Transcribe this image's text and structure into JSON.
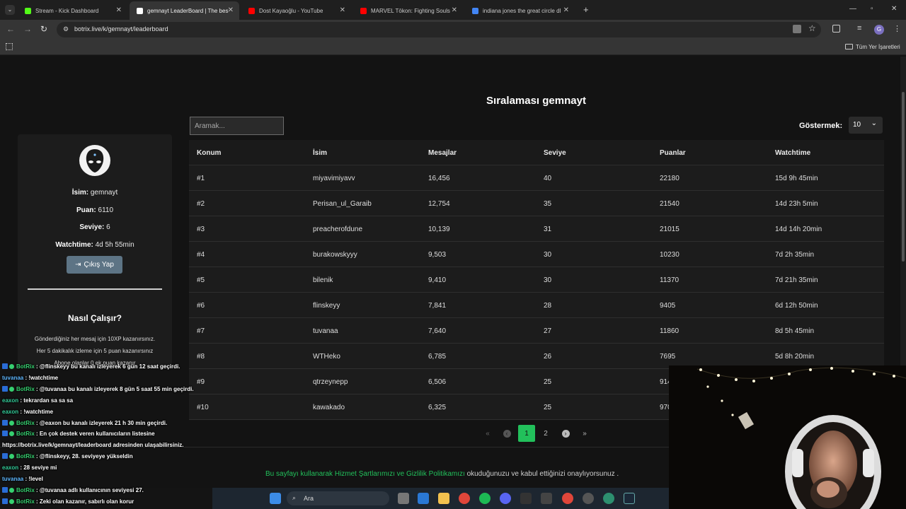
{
  "browser": {
    "tabs": [
      {
        "title": "Stream - Kick Dashboard",
        "color": "#53fc18",
        "active": false
      },
      {
        "title": "gemnayt LeaderBoard | The best",
        "color": "#ffffff",
        "active": true
      },
      {
        "title": "Dost Kayaoğlu - YouTube",
        "color": "#ff0000",
        "active": false
      },
      {
        "title": "MARVEL Tōkon: Fighting Souls",
        "color": "#ff0000",
        "active": false
      },
      {
        "title": "indiana jones the great circle dl",
        "color": "#4285f4",
        "active": false
      }
    ],
    "new_tab": "+",
    "url": "botrix.live/k/gemnayt/leaderboard",
    "bookmarks_label": "Tüm Yer İşaretleri"
  },
  "leaderboard": {
    "title": "Sıralaması gemnayt",
    "search_placeholder": "Aramak...",
    "show_label": "Göstermek:",
    "show_value": "10",
    "columns": [
      "Konum",
      "İsim",
      "Mesajlar",
      "Seviye",
      "Puanlar",
      "Watchtime"
    ],
    "rows": [
      [
        "#1",
        "miyavimiyavv",
        "16,456",
        "40",
        "22180",
        "15d 9h 45min"
      ],
      [
        "#2",
        "Perisan_ul_Garaib",
        "12,754",
        "35",
        "21540",
        "14d 23h 5min"
      ],
      [
        "#3",
        "preacherofdune",
        "10,139",
        "31",
        "21015",
        "14d 14h 20min"
      ],
      [
        "#4",
        "burakowskyyy",
        "9,503",
        "30",
        "10230",
        "7d 2h 35min"
      ],
      [
        "#5",
        "bilenik",
        "9,410",
        "30",
        "11370",
        "7d 21h 35min"
      ],
      [
        "#6",
        "flinskeyy",
        "7,841",
        "28",
        "9405",
        "6d 12h 50min"
      ],
      [
        "#7",
        "tuvanaa",
        "7,640",
        "27",
        "11860",
        "8d 5h 45min"
      ],
      [
        "#8",
        "WTHeko",
        "6,785",
        "26",
        "7695",
        "5d 8h 20min"
      ],
      [
        "#9",
        "qtrzeynepp",
        "6,506",
        "25",
        "914",
        ""
      ],
      [
        "#10",
        "kawakado",
        "6,325",
        "25",
        "970",
        ""
      ]
    ],
    "pagination": {
      "first": "«",
      "prev": "‹",
      "pages": [
        "1",
        "2"
      ],
      "next": "›",
      "last": "»",
      "current": "1"
    }
  },
  "profile": {
    "name_label": "İsim:",
    "name": "gemnayt",
    "points_label": "Puan:",
    "points": "6110",
    "level_label": "Seviye:",
    "level": "6",
    "watchtime_label": "Watchtime:",
    "watchtime": "4d 5h 55min",
    "logout": "Çıkış Yap",
    "how_title": "Nasıl Çalışır?",
    "how_lines": [
      "Gönderdiğiniz her mesaj için 10XP kazanırsınız.",
      "Her 5 dakikalık izleme için 5 puan kazanırsınız",
      "Abone olanlar 0 ek puan kazanır"
    ]
  },
  "footer": {
    "prefix": "Bu sayfayı kullanarak",
    "terms": "Hizmet Şartlarımızı",
    "and": "ve",
    "privacy": "Gizlilik Politikamızı",
    "suffix": "okuduğunuzu ve kabul ettiğinizi onaylıyorsunuz ."
  },
  "chat": [
    {
      "user": "BotRix",
      "type": "bot",
      "text": "@flinskeyy bu kanalı izleyerek 6 gün 12 saat geçirdi."
    },
    {
      "user": "tuvanaa",
      "type": "blue",
      "text": "!watchtime"
    },
    {
      "user": "BotRix",
      "type": "bot",
      "text": "@tuvanaa bu kanalı izleyerek 8 gün 5 saat 55 min geçirdi."
    },
    {
      "user": "eaxon",
      "type": "green",
      "text": "tekrardan sa sa sa"
    },
    {
      "user": "eaxon",
      "type": "green",
      "text": "!watchtime"
    },
    {
      "user": "BotRix",
      "type": "bot",
      "text": "@eaxon bu kanalı izleyerek 21 h 30 min geçirdi."
    },
    {
      "user": "BotRix",
      "type": "bot",
      "text": "En çok destek veren kullanıcıların listesine"
    },
    {
      "user": "",
      "type": "plain",
      "text": "https://botrix.live/k/gemnayt/leaderboard adresinden ulaşabilirsiniz."
    },
    {
      "user": "BotRix",
      "type": "bot",
      "text": "@flinskeyy, 28. seviyeye yükseldin"
    },
    {
      "user": "eaxon",
      "type": "green",
      "text": "28 seviye mi"
    },
    {
      "user": "tuvanaa",
      "type": "blue",
      "text": "!level"
    },
    {
      "user": "BotRix",
      "type": "bot",
      "text": "@tuvanaa adlı kullanıcının seviyesi 27."
    },
    {
      "user": "BotRix",
      "type": "bot",
      "text": "Zeki olan kazanır, sabırlı olan korur"
    }
  ],
  "taskbar": {
    "search": "Ara"
  }
}
